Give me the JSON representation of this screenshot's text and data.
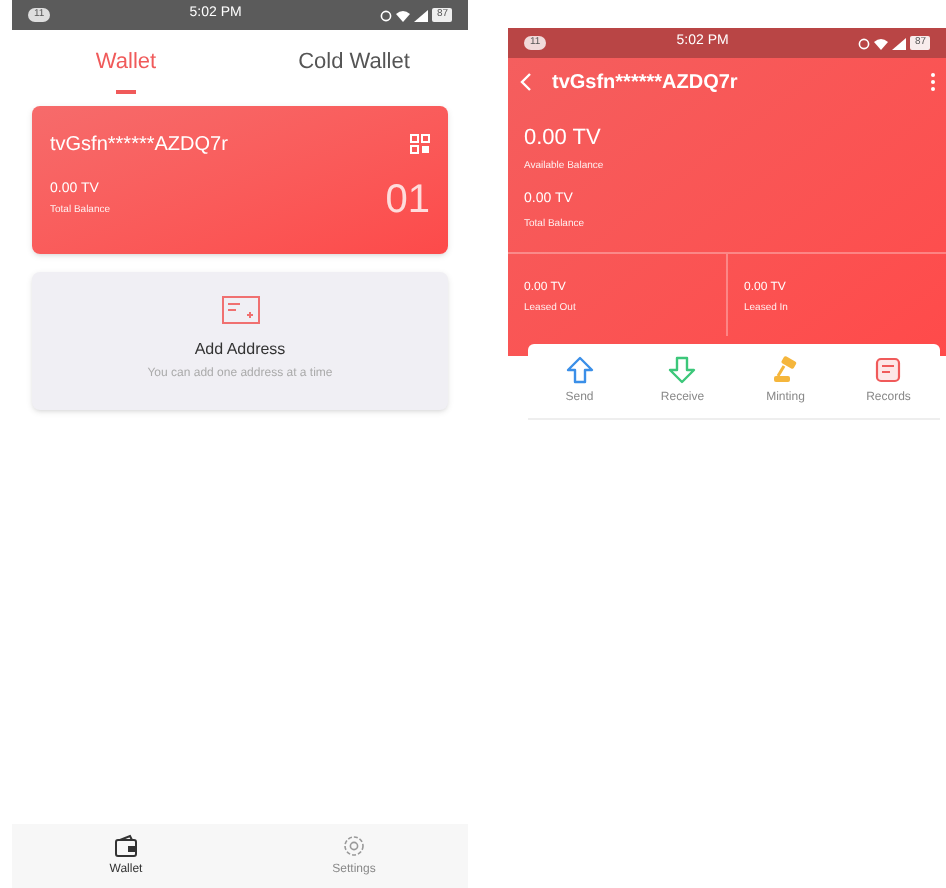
{
  "wallet_screen": {
    "status_bar": {
      "badge": "11",
      "time": "5:02 PM",
      "battery": "87"
    },
    "tabs": [
      {
        "label": "Wallet",
        "selected": true
      },
      {
        "label": "Cold Wallet",
        "selected": false
      }
    ],
    "wallet_card": {
      "address": "tvGsfn******AZDQ7r",
      "balance": "0.00 TV",
      "balance_label": "Total Balance",
      "number": "01"
    },
    "add_address": {
      "title": "Add Address",
      "subtitle": "You can add one address at a time"
    },
    "bottom_nav": [
      {
        "label": "Wallet",
        "selected": true,
        "kind": "wallet"
      },
      {
        "label": "Settings",
        "selected": false,
        "kind": "settings"
      }
    ]
  },
  "detail_screen": {
    "status_bar": {
      "badge": "11",
      "time": "5:02 PM",
      "battery": "87"
    },
    "title": "tvGsfn******AZDQ7r",
    "available": {
      "value": "0.00 TV",
      "label": "Available Balance"
    },
    "total": {
      "value": "0.00 TV",
      "label": "Total Balance"
    },
    "leased": [
      {
        "value": "0.00 TV",
        "label": "Leased Out"
      },
      {
        "value": "0.00 TV",
        "label": "Leased In"
      }
    ],
    "actions": [
      {
        "label": "Send",
        "kind": "send"
      },
      {
        "label": "Receive",
        "kind": "receive"
      },
      {
        "label": "Minting",
        "kind": "minting"
      },
      {
        "label": "Records",
        "kind": "records"
      }
    ]
  }
}
